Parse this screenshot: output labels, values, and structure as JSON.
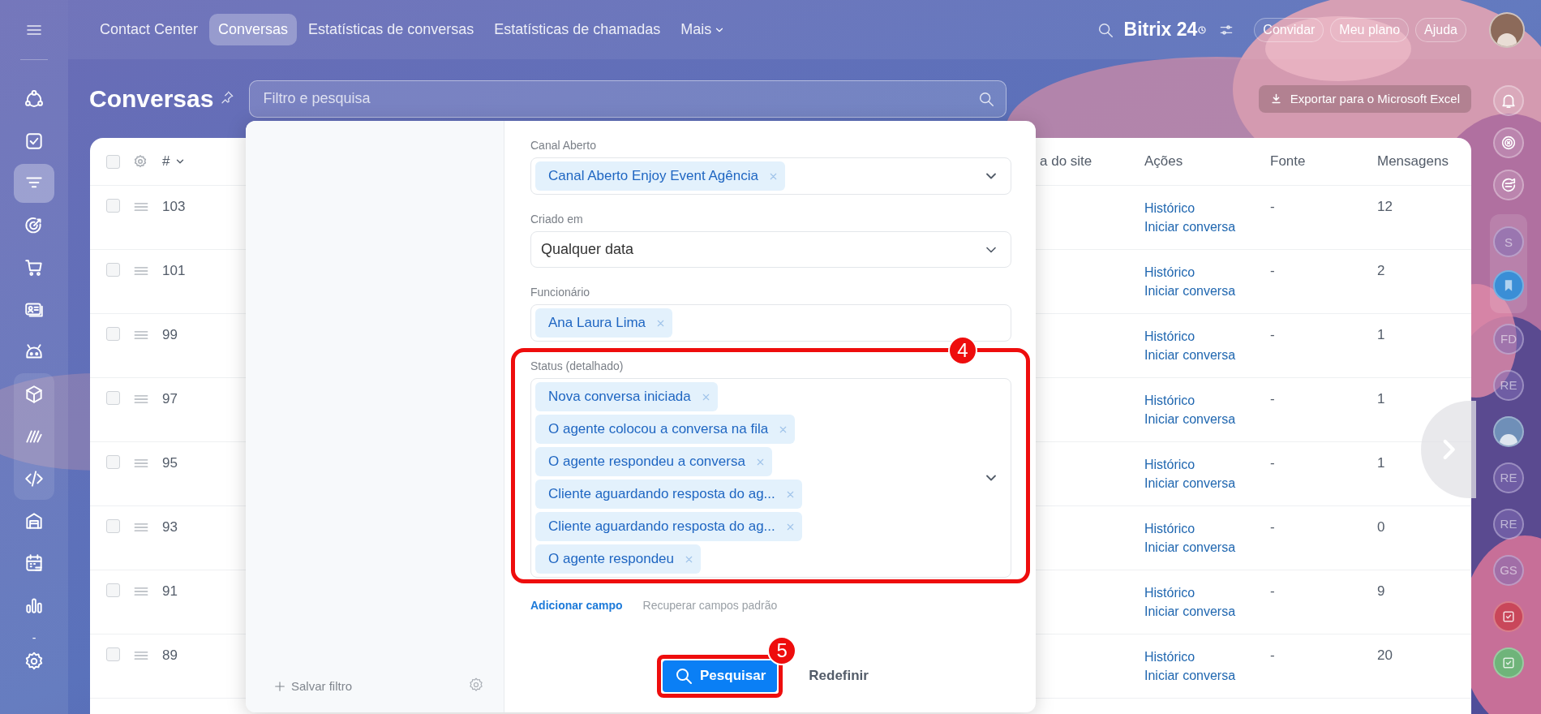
{
  "sidebar": {
    "items": [
      {
        "selected": false,
        "grouped": false
      },
      {
        "selected": false,
        "grouped": false
      },
      {
        "selected": true,
        "grouped": false
      },
      {
        "selected": false,
        "grouped": false
      },
      {
        "selected": false,
        "grouped": false
      },
      {
        "selected": false,
        "grouped": false
      },
      {
        "selected": false,
        "grouped": false
      },
      {
        "selected": false,
        "grouped": true
      },
      {
        "selected": false,
        "grouped": true
      },
      {
        "selected": false,
        "grouped": true
      },
      {
        "selected": false,
        "grouped": false
      },
      {
        "selected": false,
        "grouped": false
      },
      {
        "selected": false,
        "grouped": false
      }
    ],
    "label": "-"
  },
  "top_nav": {
    "tabs": [
      {
        "label": "Contact Center",
        "selected": false
      },
      {
        "label": "Conversas",
        "selected": true
      },
      {
        "label": "Estatísticas de conversas",
        "selected": false
      },
      {
        "label": "Estatísticas de chamadas",
        "selected": false
      }
    ],
    "more": "Mais",
    "logo": "Bitrix 24",
    "buttons": [
      "Convidar",
      "Meu plano",
      "Ajuda"
    ]
  },
  "page": {
    "title": "Conversas",
    "search": {
      "placeholder": "Filtro e pesquisa"
    },
    "export_button": "Exportar para o Microsoft Excel"
  },
  "table": {
    "header_checked": false,
    "id_column": "#",
    "columns": [
      "a do site",
      "Ações",
      "Fonte",
      "Mensagens"
    ],
    "rows": [
      {
        "checked": false,
        "id": "103",
        "actions": [
          "Histórico",
          "Iniciar conversa"
        ],
        "fonte": "-",
        "mensagens": "12"
      },
      {
        "checked": false,
        "id": "101",
        "actions": [
          "Histórico",
          "Iniciar conversa"
        ],
        "fonte": "-",
        "mensagens": "2"
      },
      {
        "checked": false,
        "id": "99",
        "actions": [
          "Histórico",
          "Iniciar conversa"
        ],
        "fonte": "-",
        "mensagens": "1"
      },
      {
        "checked": false,
        "id": "97",
        "actions": [
          "Histórico",
          "Iniciar conversa"
        ],
        "fonte": "-",
        "mensagens": "1"
      },
      {
        "checked": false,
        "id": "95",
        "actions": [
          "Histórico",
          "Iniciar conversa"
        ],
        "fonte": "-",
        "mensagens": "1"
      },
      {
        "checked": false,
        "id": "93",
        "actions": [
          "Histórico",
          "Iniciar conversa"
        ],
        "fonte": "-",
        "mensagens": "0"
      },
      {
        "checked": false,
        "id": "91",
        "actions": [
          "Histórico",
          "Iniciar conversa"
        ],
        "fonte": "-",
        "mensagens": "9"
      },
      {
        "checked": false,
        "id": "89",
        "actions": [
          "Histórico",
          "Iniciar conversa"
        ],
        "fonte": "-",
        "mensagens": "20"
      }
    ]
  },
  "filter": {
    "save_filter": "Salvar filtro",
    "fields": [
      {
        "label": "Canal Aberto",
        "kind": "tags",
        "dropdown": true,
        "tags": [
          "Canal Aberto Enjoy Event Agência"
        ]
      },
      {
        "label": "Criado em",
        "kind": "select",
        "value": "Qualquer data"
      },
      {
        "label": "Funcionário",
        "kind": "tags",
        "dropdown": false,
        "tags": [
          "Ana Laura Lima"
        ]
      },
      {
        "label": "Status (detalhado)",
        "kind": "tags",
        "dropdown": true,
        "stacked": true,
        "annotation": "4",
        "tags": [
          "Nova conversa iniciada",
          "O agente colocou a conversa na fila",
          "O agente respondeu a conversa",
          "Cliente aguardando resposta do ag...",
          "Cliente aguardando resposta do ag...",
          "O agente respondeu"
        ]
      }
    ],
    "add_field": "Adicionar campo",
    "restore_fields": "Recuperar campos padrão",
    "search_button": {
      "label": "Pesquisar",
      "annotation": "5"
    },
    "reset_button": "Redefinir"
  },
  "right_panel": {
    "items": [
      {
        "kind": "icon",
        "grouped": false
      },
      {
        "kind": "icon",
        "grouped": false
      },
      {
        "kind": "icon",
        "grouped": false
      },
      {
        "kind": "initials",
        "text": "S",
        "grouped": true
      },
      {
        "kind": "app",
        "color": "#3a8ed6",
        "grouped": true
      },
      {
        "kind": "initials",
        "text": "FD",
        "grouped": false
      },
      {
        "kind": "initials",
        "text": "RE",
        "grouped": false
      },
      {
        "kind": "avatar",
        "grouped": false
      },
      {
        "kind": "initials",
        "text": "RE",
        "grouped": false
      },
      {
        "kind": "initials",
        "text": "RE",
        "grouped": false
      },
      {
        "kind": "initials",
        "text": "GS",
        "grouped": false
      },
      {
        "kind": "app",
        "color": "#c9475a",
        "grouped": false
      },
      {
        "kind": "app",
        "color": "#6fb47a",
        "grouped": false
      }
    ]
  }
}
